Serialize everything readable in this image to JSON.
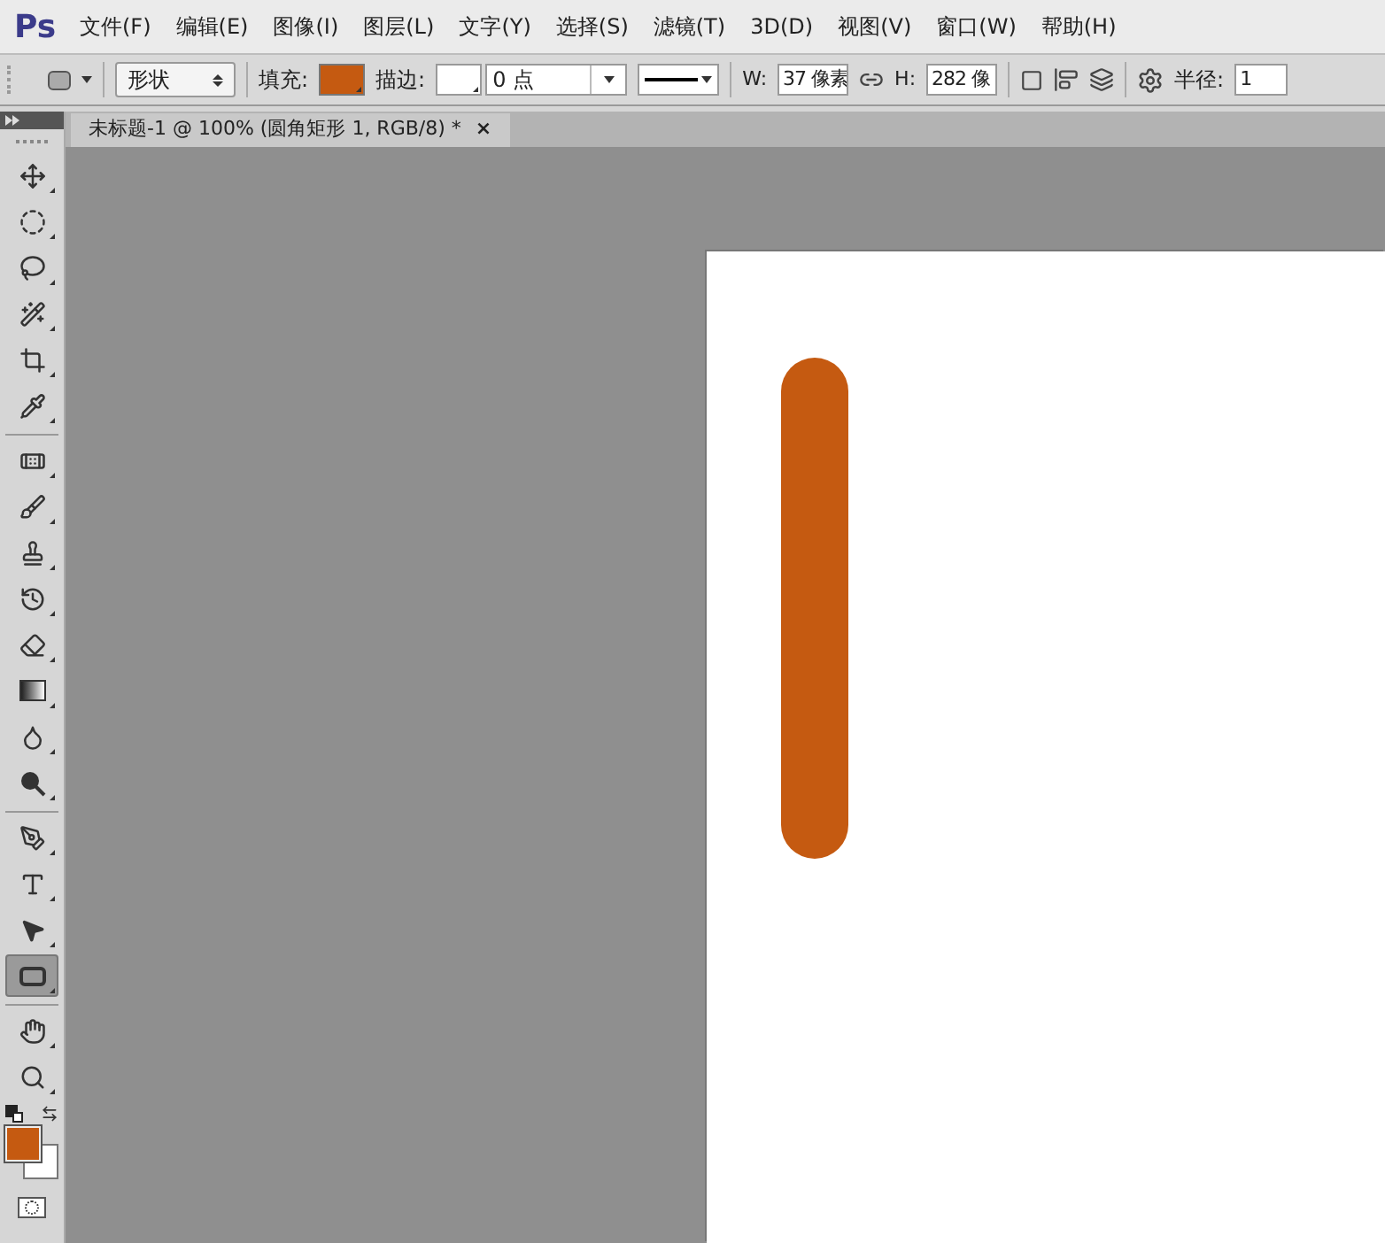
{
  "app_logo": "Ps",
  "menu": [
    {
      "label": "文件(F)"
    },
    {
      "label": "编辑(E)"
    },
    {
      "label": "图像(I)"
    },
    {
      "label": "图层(L)"
    },
    {
      "label": "文字(Y)"
    },
    {
      "label": "选择(S)"
    },
    {
      "label": "滤镜(T)"
    },
    {
      "label": "3D(D)"
    },
    {
      "label": "视图(V)"
    },
    {
      "label": "窗口(W)"
    },
    {
      "label": "帮助(H)"
    }
  ],
  "options_bar": {
    "mode": "形状",
    "fill_label": "填充:",
    "stroke_label": "描边:",
    "stroke_width": "0 点",
    "w_label": "W:",
    "w_value": "37 像素",
    "h_label": "H:",
    "h_value": "282 像",
    "radius_label": "半径:",
    "radius_value": "1"
  },
  "document_tab": {
    "title": "未标题-1 @ 100% (圆角矩形 1, RGB/8) *",
    "close": "×"
  },
  "tool_groups": [
    {
      "tools": [
        {
          "kind": "move",
          "selected": false
        },
        {
          "kind": "marquee",
          "selected": false
        },
        {
          "kind": "lasso",
          "selected": false
        },
        {
          "kind": "wand",
          "selected": false
        },
        {
          "kind": "crop",
          "selected": false
        },
        {
          "kind": "eyedropper",
          "selected": false
        }
      ]
    },
    {
      "tools": [
        {
          "kind": "healing",
          "selected": false
        },
        {
          "kind": "brush",
          "selected": false
        },
        {
          "kind": "stamp",
          "selected": false
        },
        {
          "kind": "history",
          "selected": false
        },
        {
          "kind": "eraser",
          "selected": false
        },
        {
          "kind": "gradient",
          "selected": false
        },
        {
          "kind": "blur",
          "selected": false
        },
        {
          "kind": "dodge",
          "selected": false
        }
      ]
    },
    {
      "tools": [
        {
          "kind": "pen",
          "selected": false
        },
        {
          "kind": "type",
          "selected": false
        },
        {
          "kind": "select",
          "selected": false
        },
        {
          "kind": "shape",
          "selected": true
        }
      ]
    },
    {
      "tools": [
        {
          "kind": "hand",
          "selected": false
        },
        {
          "kind": "zoom",
          "selected": false
        }
      ]
    }
  ]
}
